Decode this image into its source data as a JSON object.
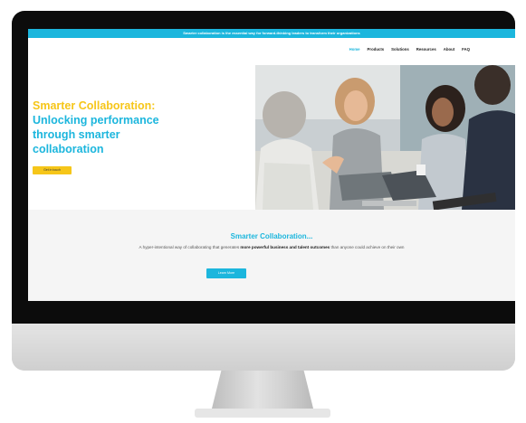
{
  "announcement": "Smarter collaboration is the essential way for forward-thinking leaders to transform their organizations",
  "nav": {
    "items": [
      "Home",
      "Products",
      "Solutions",
      "Resources",
      "About",
      "FAQ"
    ],
    "active": "Home"
  },
  "hero": {
    "title_line1": "Smarter Collaboration:",
    "title_line2": "Unlocking performance through smarter collaboration",
    "cta_label": "Get in touch"
  },
  "section": {
    "title": "Smarter Collaboration...",
    "text_plain_1": "A hyper-intentional way of collaborating that generates ",
    "text_bold_1": "more powerful business and talent outcomes",
    "text_plain_2": " than anyone could achieve on their own",
    "button_label": "Learn More"
  },
  "colors": {
    "accent_blue": "#1cb6dd",
    "accent_yellow": "#f6c619"
  }
}
